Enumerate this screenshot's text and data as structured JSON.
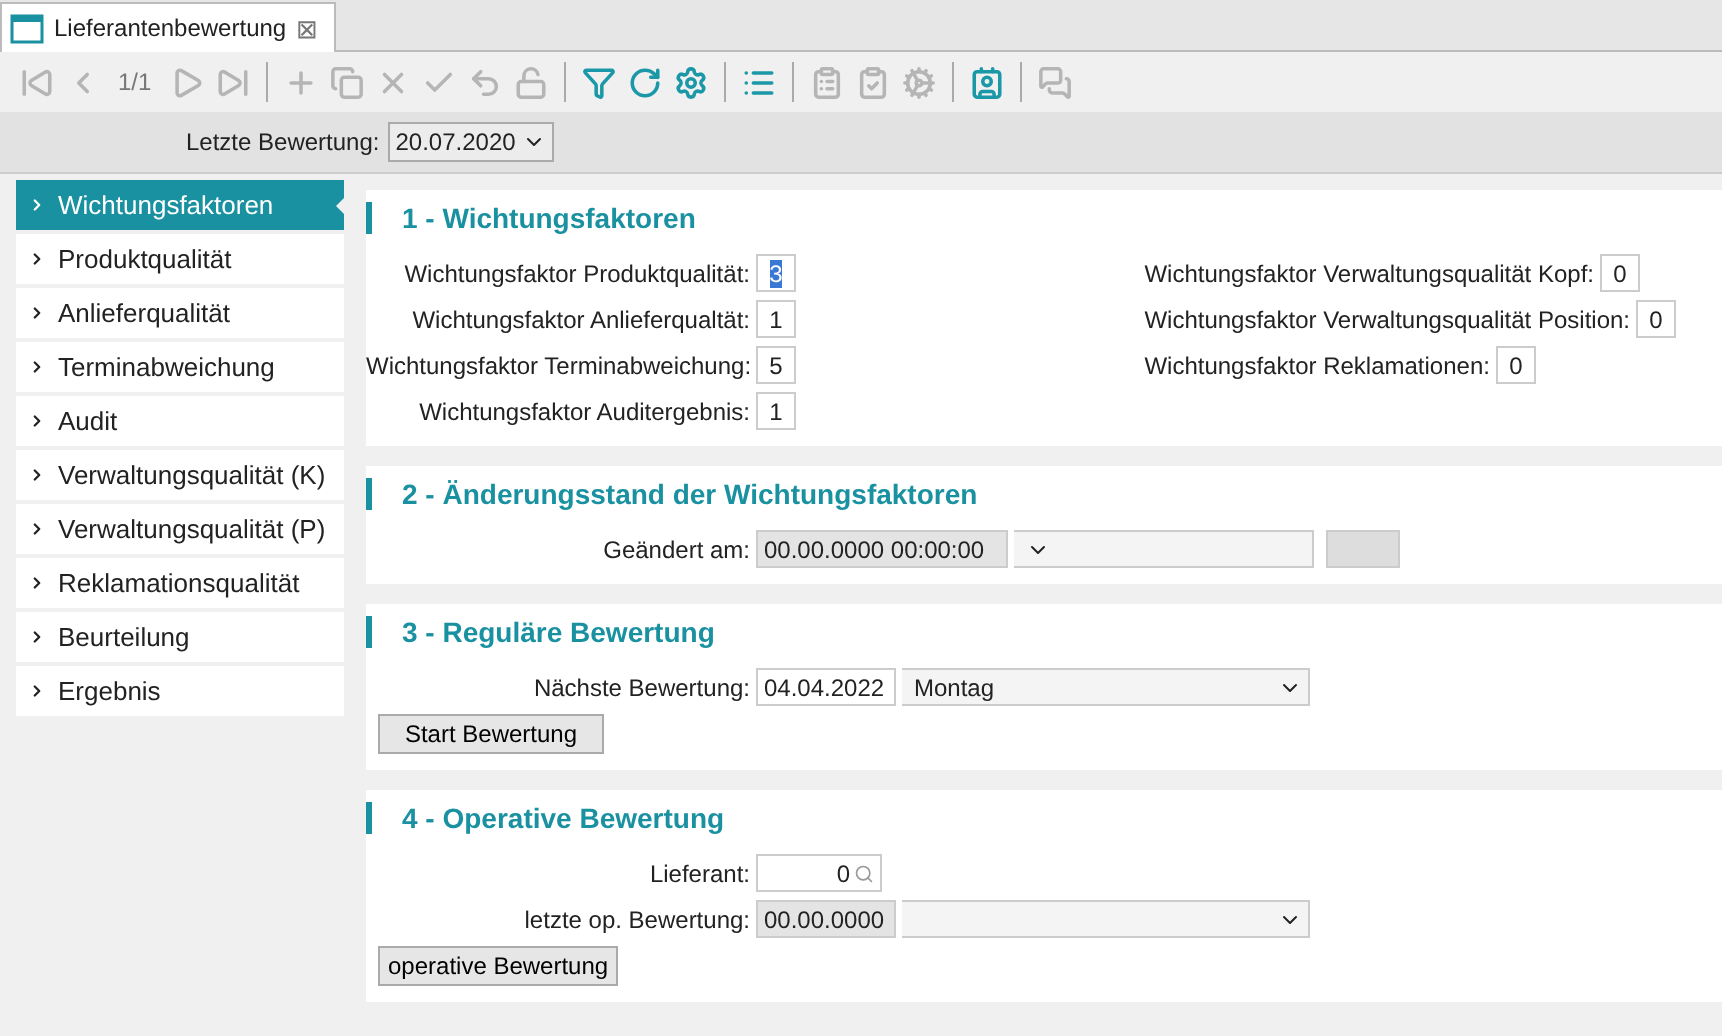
{
  "tab": {
    "title": "Lieferantenbewertung",
    "close": "⊠"
  },
  "toolbar": {
    "page_counter": "1/1",
    "buttons": [
      {
        "disabled": true
      },
      {
        "disabled": true
      },
      {
        "disabled": true
      },
      {
        "disabled": true
      },
      {
        "disabled": true
      },
      {
        "disabled": true
      },
      {
        "disabled": true
      },
      {
        "disabled": true
      },
      {
        "disabled": true
      },
      {
        "disabled": true
      },
      {
        "disabled": false
      },
      {
        "disabled": false
      },
      {
        "disabled": false
      },
      {
        "disabled": false
      },
      {
        "disabled": true
      },
      {
        "disabled": true
      },
      {
        "disabled": true
      },
      {
        "disabled": false
      },
      {
        "disabled": true
      }
    ]
  },
  "filter": {
    "label": "Letzte Bewertung:",
    "value": "20.07.2020"
  },
  "sidebar": {
    "items": [
      {
        "label": "Wichtungsfaktoren",
        "selected": true
      },
      {
        "label": "Produktqualität",
        "selected": false
      },
      {
        "label": "Anlieferqualität",
        "selected": false
      },
      {
        "label": "Terminabweichung",
        "selected": false
      },
      {
        "label": "Audit",
        "selected": false
      },
      {
        "label": "Verwaltungsqualität (K)",
        "selected": false
      },
      {
        "label": "Verwaltungsqualität (P)",
        "selected": false
      },
      {
        "label": "Reklamationsqualität",
        "selected": false
      },
      {
        "label": "Beurteilung",
        "selected": false
      },
      {
        "label": "Ergebnis",
        "selected": false
      }
    ]
  },
  "sections": [
    {
      "title": "1 - Wichtungsfaktoren",
      "columns": [
        [
          {
            "kind": "number",
            "label": "Wichtungsfaktor Produktqualität:",
            "value": "3",
            "focused": true
          },
          {
            "kind": "number",
            "label": "Wichtungsfaktor Anlieferqualtät:",
            "value": "1",
            "focused": false
          },
          {
            "kind": "number",
            "label": "Wichtungsfaktor Terminabweichung:",
            "value": "5",
            "focused": false
          },
          {
            "kind": "number",
            "label": "Wichtungsfaktor Auditergebnis:",
            "value": "1",
            "focused": false
          }
        ],
        [
          {
            "kind": "number",
            "label": "Wichtungsfaktor Verwaltungsqualität Kopf:",
            "value": "0",
            "focused": false
          },
          {
            "kind": "number",
            "label": "Wichtungsfaktor Verwaltungsqualität Position:",
            "value": "0",
            "focused": false
          },
          {
            "kind": "number",
            "label": "Wichtungsfaktor Reklamationen:",
            "value": "0",
            "focused": false
          }
        ]
      ]
    },
    {
      "title": "2 - Änderungsstand der Wichtungsfaktoren",
      "columns": [
        [
          {
            "kind": "datetime",
            "label": "Geändert am:",
            "value": "00.00.0000 00:00:00"
          }
        ]
      ]
    },
    {
      "title": "3 - Reguläre Bewertung",
      "columns": [
        [
          {
            "kind": "date",
            "label": "Nächste Bewertung:",
            "value": "04.04.2022",
            "option": "Montag",
            "readonly": false
          }
        ]
      ],
      "button": "Start Bewertung"
    },
    {
      "title": "4 - Operative Bewertung",
      "columns": [
        [
          {
            "kind": "lookup",
            "label": "Lieferant:",
            "value": "0"
          },
          {
            "kind": "date",
            "label": "letzte op. Bewertung:",
            "value": "00.00.0000",
            "readonly": true
          }
        ]
      ],
      "button": "operative Bewertung"
    }
  ]
}
